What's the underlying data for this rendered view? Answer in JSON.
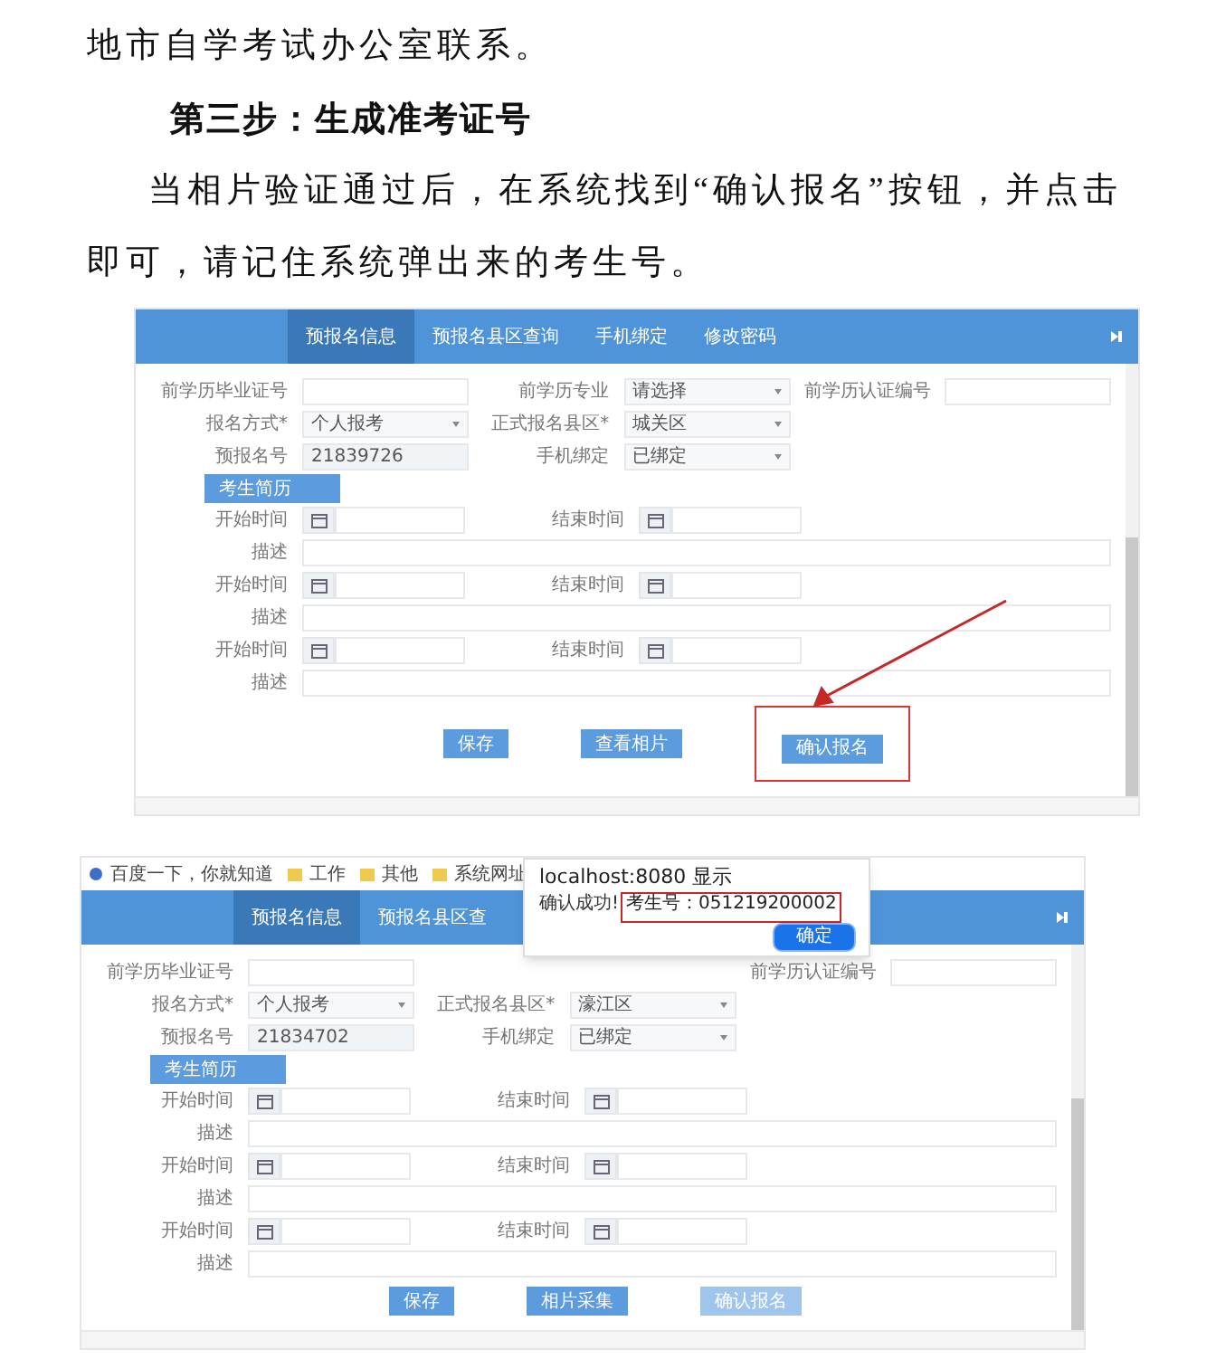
{
  "document": {
    "paragraph_end": "地市自学考试办公室联系。",
    "heading": "第三步：生成准考证号",
    "paragraph": "当相片验证通过后，在系统找到“确认报名”按钮，并点击即可，请记住系统弹出来的考生号。"
  },
  "screenshots": [
    {
      "tabs": [
        {
          "label": "预报名信息",
          "selected": true
        },
        {
          "label": "预报名县区查询",
          "selected": false
        },
        {
          "label": "手机绑定",
          "selected": false
        },
        {
          "label": "修改密码",
          "selected": false
        }
      ],
      "fields": [
        {
          "label": "前学历毕业证号",
          "kind": "input"
        },
        {
          "label": "前学历专业",
          "kind": "select",
          "value": "请选择"
        },
        {
          "label": "前学历认证编号",
          "kind": "input"
        },
        {
          "label": "报名方式*",
          "kind": "select",
          "value": "个人报考"
        },
        {
          "label": "正式报名县区*",
          "kind": "select",
          "value": "城关区"
        },
        {
          "kind": "blank"
        },
        {
          "label": "预报名号",
          "kind": "readonly",
          "value": "21839726"
        },
        {
          "label": "手机绑定",
          "kind": "select",
          "value": "已绑定"
        }
      ],
      "section": "考生简历",
      "resume": [
        {
          "start": "开始时间",
          "end": "结束时间",
          "description": "描述"
        },
        {
          "start": "开始时间",
          "end": "结束时间",
          "description": "描述"
        },
        {
          "start": "开始时间",
          "end": "结束时间",
          "description": "描述"
        }
      ],
      "buttons": [
        {
          "label": "保存",
          "disabled": false,
          "highlighted": false
        },
        {
          "label": "查看相片",
          "disabled": false,
          "highlighted": false
        },
        {
          "label": "确认报名",
          "disabled": false,
          "highlighted": true
        }
      ]
    },
    {
      "bookmarks": [
        {
          "label": "百度一下，你就知道",
          "kind": "site"
        },
        {
          "label": "工作",
          "kind": "folder"
        },
        {
          "label": "其他",
          "kind": "folder"
        },
        {
          "label": "系统网址",
          "kind": "folder"
        }
      ],
      "tabs": [
        {
          "label": "预报名信息",
          "selected": true
        },
        {
          "label": "预报名县区查",
          "selected": false
        }
      ],
      "fields": [
        {
          "label": "前学历毕业证号",
          "kind": "input"
        },
        {
          "kind": "blank"
        },
        {
          "label": "前学历认证编号",
          "kind": "input"
        },
        {
          "label": "报名方式*",
          "kind": "select",
          "value": "个人报考"
        },
        {
          "label": "正式报名县区*",
          "kind": "select",
          "value": "濠江区"
        },
        {
          "kind": "blank"
        },
        {
          "label": "预报名号",
          "kind": "readonly",
          "value": "21834702"
        },
        {
          "label": "手机绑定",
          "kind": "select",
          "value": "已绑定"
        }
      ],
      "section": "考生简历",
      "resume": [
        {
          "start": "开始时间",
          "end": "结束时间",
          "description": "描述"
        },
        {
          "start": "开始时间",
          "end": "结束时间",
          "description": "描述"
        },
        {
          "start": "开始时间",
          "end": "结束时间",
          "description": "描述"
        }
      ],
      "buttons": [
        {
          "label": "保存",
          "disabled": false,
          "highlighted": false
        },
        {
          "label": "相片采集",
          "disabled": false,
          "highlighted": false
        },
        {
          "label": "确认报名",
          "disabled": true,
          "highlighted": false
        }
      ],
      "dialog": {
        "title": "localhost:8080 显示",
        "message": "确认成功!",
        "highlight": "考生号：051219200002",
        "button": "确定"
      }
    }
  ]
}
